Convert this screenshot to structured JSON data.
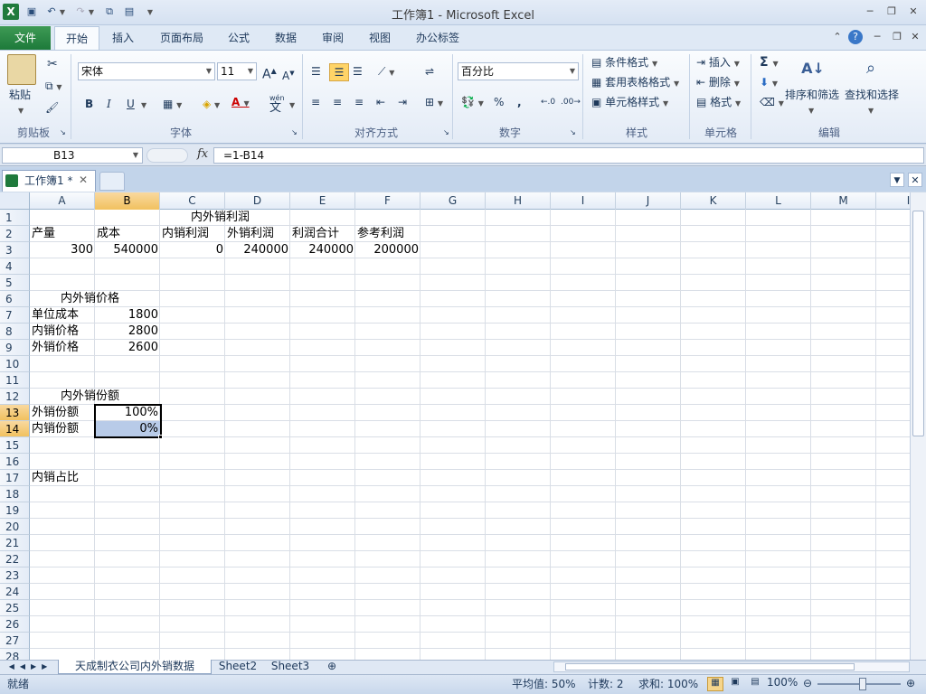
{
  "window": {
    "title": "工作簿1 - Microsoft Excel"
  },
  "ribbon_tabs": [
    "文件",
    "开始",
    "插入",
    "页面布局",
    "公式",
    "数据",
    "审阅",
    "视图",
    "办公标签"
  ],
  "clipboard": {
    "paste": "粘贴",
    "label": "剪贴板"
  },
  "font": {
    "name": "宋体",
    "size": "11",
    "bold": "B",
    "italic": "I",
    "underline": "U",
    "label": "字体",
    "wen": "wén",
    "wen_char": "文"
  },
  "alignment": {
    "label": "对齐方式"
  },
  "number": {
    "format": "百分比",
    "percent": "%",
    "comma": ",",
    "label": "数字",
    "inc_dec": "+.0\n.00",
    "dec_dec": ".00\n+.0"
  },
  "styles": {
    "conditional": "条件格式",
    "table": "套用表格格式",
    "cell": "单元格样式",
    "label": "样式"
  },
  "cells_group": {
    "insert": "插入",
    "delete": "删除",
    "format": "格式",
    "label": "单元格"
  },
  "editing": {
    "sigma": "Σ",
    "sort": "排序和筛选",
    "find": "查找和选择",
    "label": "编辑"
  },
  "formula_bar": {
    "name_box": "B13",
    "fx": "fx",
    "formula": "=1-B14"
  },
  "workbook_tab": "工作簿1 *",
  "columns": [
    "A",
    "B",
    "C",
    "D",
    "E",
    "F",
    "G",
    "H",
    "I",
    "J",
    "K",
    "L",
    "M",
    "I"
  ],
  "rows": [
    "1",
    "2",
    "3",
    "4",
    "5",
    "6",
    "7",
    "8",
    "9",
    "10",
    "11",
    "12",
    "13",
    "14",
    "15",
    "16",
    "17",
    "18",
    "19",
    "20",
    "21",
    "22",
    "23",
    "24",
    "25",
    "26",
    "27",
    "28"
  ],
  "cells": {
    "C1": "内外销利润",
    "A2": "产量",
    "B2": "成本",
    "C2": "内销利润",
    "D2": "外销利润",
    "E2": "利润合计",
    "F2": "参考利润",
    "A3": "300",
    "B3": "540000",
    "C3": "0",
    "D3": "240000",
    "E3": "240000",
    "F3": "200000",
    "A6": "内外销价格",
    "A7": "单位成本",
    "B7": "1800",
    "A8": "内销价格",
    "B8": "2800",
    "A9": "外销价格",
    "B9": "2600",
    "A12": "内外销份额",
    "A13": "外销份额",
    "B13": "100%",
    "A14": "内销份额",
    "B14": "0%",
    "A17": "内销占比"
  },
  "sheets": [
    "天成制衣公司内外销数据",
    "Sheet2",
    "Sheet3"
  ],
  "status": {
    "ready": "就绪",
    "average": "平均值: 50%",
    "count": "计数: 2",
    "sum": "求和: 100%",
    "zoom": "100%"
  },
  "colors": {
    "file_tab": "#1d7a3a",
    "selection_header": "#f1c15f",
    "selected_cell_fill": "#b8cbe8"
  }
}
